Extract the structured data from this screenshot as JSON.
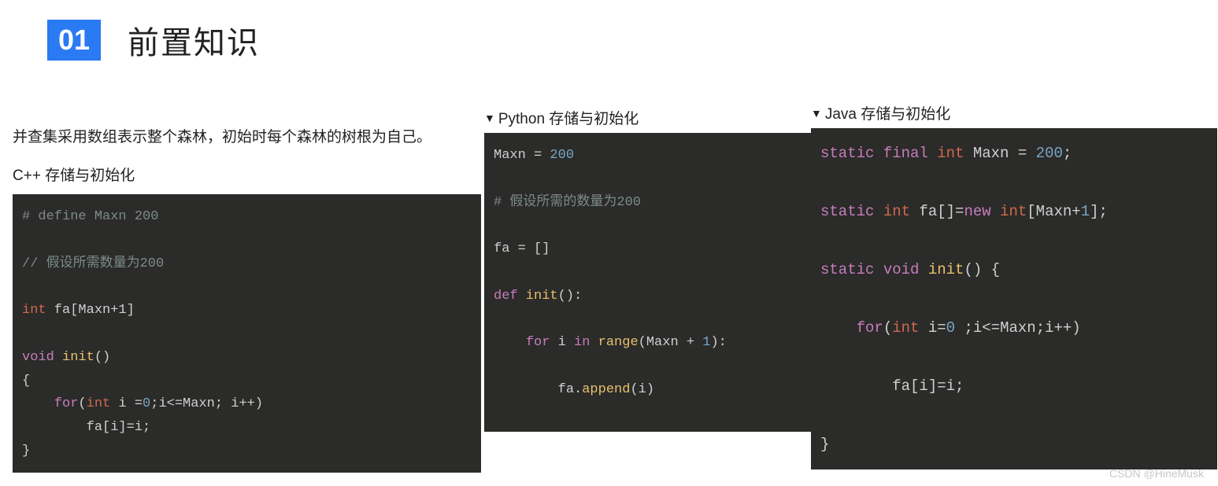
{
  "header": {
    "badge": "01",
    "title": "前置知识"
  },
  "left": {
    "description": "并查集采用数组表示整个森林，初始时每个森林的树根为自己。",
    "subhead": "C++ 存储与初始化",
    "code": {
      "l1a": "# define Maxn 200",
      "l2a": "// 假设所需数量为200",
      "l3_int": "int",
      "l3_rest": " fa[Maxn+1]",
      "l4_void": "void",
      "l4_fn": " init",
      "l4_rest": "()",
      "l5": "{",
      "l6_a": "    ",
      "l6_for": "for",
      "l6_b": "(",
      "l6_int": "int",
      "l6_c": " i =",
      "l6_zero": "0",
      "l6_d": ";i<=Maxn; i++)",
      "l7": "        fa[i]=i;",
      "l8": "}"
    }
  },
  "mid": {
    "disclosure": "Python 存储与初始化",
    "code": {
      "l1a": "Maxn = ",
      "l1_num": "200",
      "l2a": "# 假设所需的数量为200",
      "l3": "fa = []",
      "l4_def": "def",
      "l4_fn": " init",
      "l4_rest": "():",
      "l5_a": "    ",
      "l5_for": "for",
      "l5_b": " i ",
      "l5_in": "in",
      "l5_c": " ",
      "l5_range": "range",
      "l5_d": "(Maxn + ",
      "l5_one": "1",
      "l5_e": "):",
      "l6_a": "        fa.",
      "l6_append": "append",
      "l6_b": "(i)"
    }
  },
  "right": {
    "disclosure": "Java 存储与初始化",
    "code": {
      "l1_static": "static",
      "l1_final": " final",
      "l1_int": " int",
      "l1_rest": " Maxn = ",
      "l1_num": "200",
      "l1_semi": ";",
      "l2_static": "static",
      "l2_int": " int",
      "l2_a": " fa[]=",
      "l2_new": "new",
      "l2_int2": " int",
      "l2_b": "[Maxn+",
      "l2_one": "1",
      "l2_c": "];",
      "l3_static": "static",
      "l3_void": " void",
      "l3_fn": " init",
      "l3_rest": "() {",
      "l4_a": "    ",
      "l4_for": "for",
      "l4_b": "(",
      "l4_int": "int",
      "l4_c": " i=",
      "l4_zero": "0",
      "l4_d": " ;i<=Maxn;i++)",
      "l5": "        fa[i]=i;",
      "l6": "}"
    }
  },
  "watermark": "CSDN @HineMusk"
}
